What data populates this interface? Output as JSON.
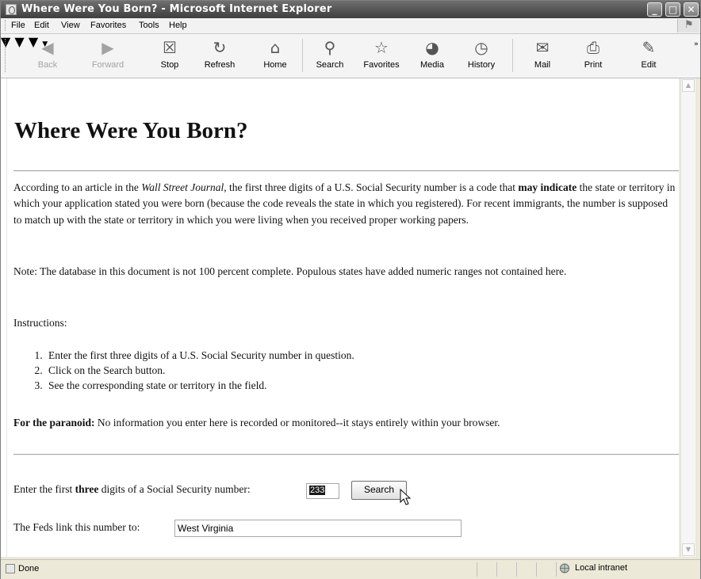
{
  "window": {
    "title": "Where Were You Born? - Microsoft Internet Explorer"
  },
  "menu": {
    "items": [
      "File",
      "Edit",
      "View",
      "Favorites",
      "Tools",
      "Help"
    ]
  },
  "toolbar": {
    "back": "Back",
    "forward": "Forward",
    "stop": "Stop",
    "refresh": "Refresh",
    "home": "Home",
    "search": "Search",
    "favorites": "Favorites",
    "media": "Media",
    "history": "History",
    "mail": "Mail",
    "print": "Print",
    "edit": "Edit"
  },
  "page": {
    "heading": "Where Were You Born?",
    "p1": {
      "t1": "According to an article in the ",
      "journal": "Wall Street Journal",
      "t2": ", the first three digits of a U.S. Social Security number is a code that ",
      "may": "may indicate",
      "t3": " the state or territory in which your application stated you were born (because the code reveals the state in which you registered). For recent immigrants, the number is supposed to match up with the state or territory in which you were living when you received proper working papers."
    },
    "note": "Note: The database in this document is not 100 percent complete. Populous states have added numeric ranges not contained here.",
    "instructions_label": "Instructions:",
    "steps": [
      "Enter the first three digits of a U.S. Social Security number in question.",
      "Click on the Search button.",
      "See the corresponding state or territory in the field."
    ],
    "paranoid_label": "For the paranoid:",
    "paranoid_text": " No information you enter here is recorded or monitored--it stays entirely within your browser.",
    "form": {
      "prompt_pre": "Enter the first ",
      "prompt_bold": "three",
      "prompt_post": " digits of a Social Security number:",
      "ssn_value": "233",
      "search_button": "Search",
      "result_label": "The Feds link this number to:",
      "result_value": "West Virginia"
    }
  },
  "status": {
    "text": "Done",
    "zone": "Local intranet"
  }
}
